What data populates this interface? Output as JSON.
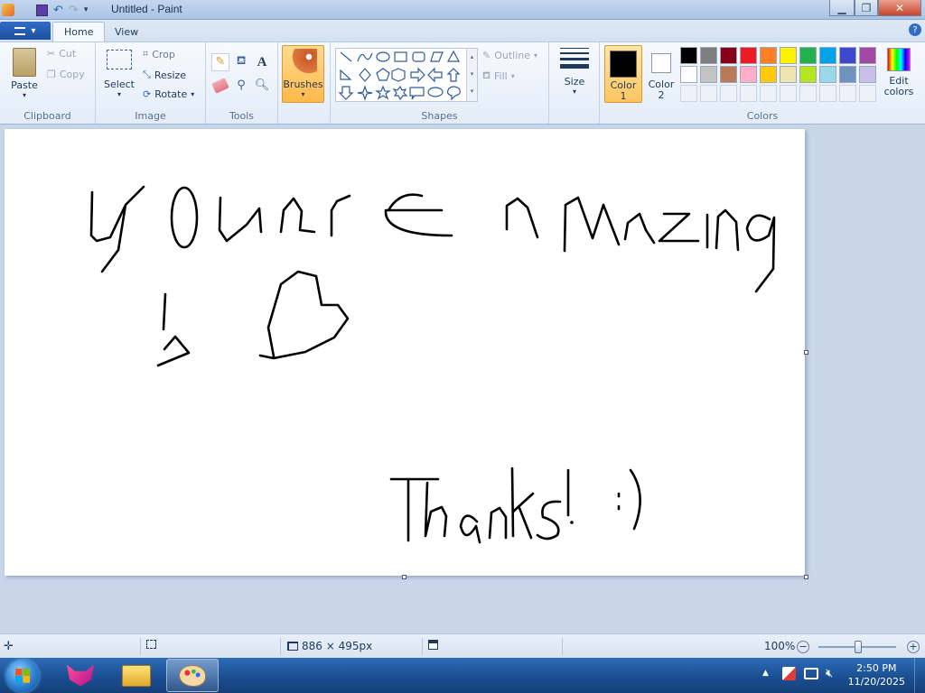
{
  "window": {
    "title": "Untitled - Paint"
  },
  "tabs": [
    {
      "label": "Home"
    },
    {
      "label": "View"
    }
  ],
  "ribbon": {
    "clipboard": {
      "label": "Clipboard",
      "paste": "Paste",
      "cut": "Cut",
      "copy": "Copy"
    },
    "image": {
      "label": "Image",
      "select": "Select",
      "crop": "Crop",
      "resize": "Resize",
      "rotate": "Rotate"
    },
    "tools": {
      "label": "Tools"
    },
    "brushes": {
      "label": "Brushes"
    },
    "shapes": {
      "label": "Shapes",
      "outline": "Outline",
      "fill": "Fill"
    },
    "size": {
      "label": "Size"
    },
    "colors": {
      "label": "Colors",
      "color1": "Color 1",
      "color2": "Color 2",
      "edit": "Edit colors",
      "row1": [
        "#000000",
        "#7f7f7f",
        "#880015",
        "#ed1c24",
        "#ff7f27",
        "#fff200",
        "#22b14c",
        "#00a2e8",
        "#3f48cc",
        "#a349a4"
      ],
      "row2": [
        "#ffffff",
        "#c3c3c3",
        "#b97a57",
        "#ffaec9",
        "#ffc90e",
        "#efe4b0",
        "#b5e61d",
        "#99d9ea",
        "#7092be",
        "#c8bfe7"
      ]
    }
  },
  "canvas": {
    "line1": "youare amazing",
    "line2": "!",
    "line3": "Thanks! :)"
  },
  "status": {
    "dimensions": "886 × 495px",
    "zoom": "100%"
  },
  "taskbar": {
    "time": "2:50 PM",
    "date": "11/20/2025"
  }
}
